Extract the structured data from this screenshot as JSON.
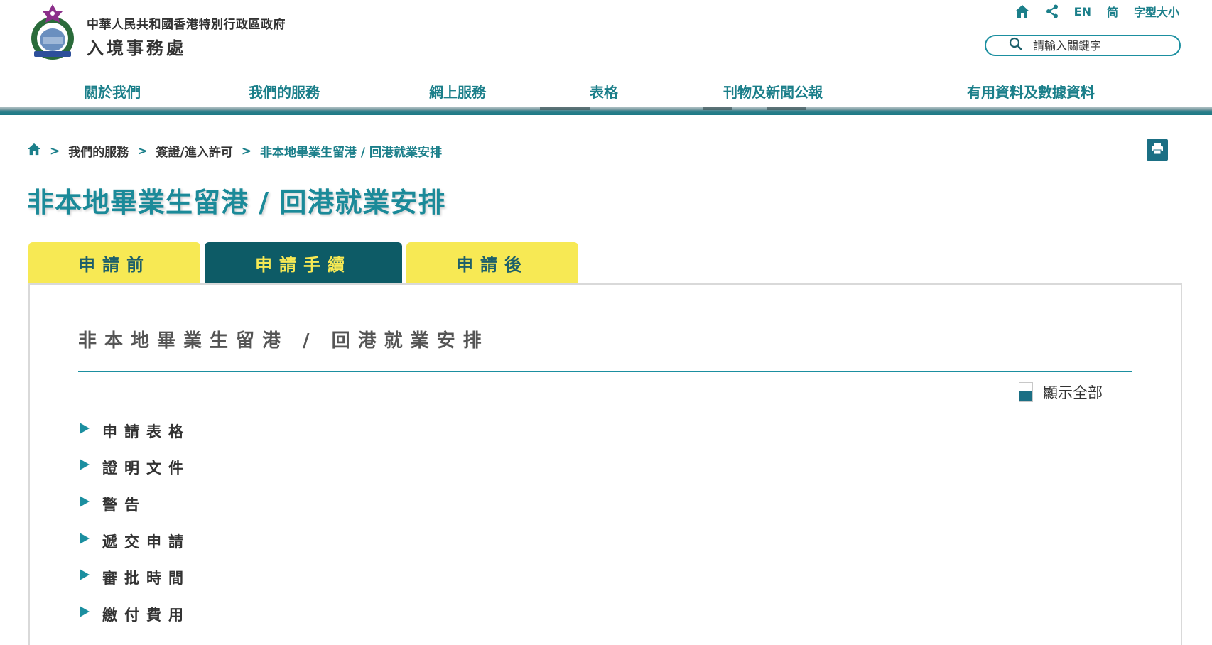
{
  "header": {
    "dept_line1": "中華人民共和國香港特別行政區政府",
    "dept_line2": "入境事務處",
    "util": {
      "home_icon": "home-icon",
      "share_icon": "share-icon",
      "lang_en": "EN",
      "lang_sc": "简",
      "font_size": "字型大小"
    },
    "search": {
      "placeholder": "請輸入關鍵字",
      "icon": "search-icon"
    }
  },
  "nav": {
    "items": [
      "關於我們",
      "我們的服務",
      "網上服務",
      "表格",
      "刊物及新聞公報",
      "有用資料及數據資料"
    ]
  },
  "breadcrumb": {
    "home_icon": "home-icon",
    "separator": ">",
    "items": [
      "我們的服務",
      "簽證/進入許可",
      "非本地畢業生留港 / 回港就業安排"
    ]
  },
  "page_title": "非本地畢業生留港 / 回港就業安排",
  "tabs": [
    {
      "label": "申請前",
      "active": false
    },
    {
      "label": "申請手續",
      "active": true
    },
    {
      "label": "申請後",
      "active": false
    }
  ],
  "panel": {
    "heading": "非本地畢業生留港 / 回港就業安排",
    "show_all_label": "顯示全部",
    "sections": [
      "申請表格",
      "證明文件",
      "警告",
      "遞交申請",
      "審批時間",
      "繳付費用"
    ]
  },
  "colors": {
    "accent": "#1b8fa0",
    "tab_active_bg": "#0d5b66",
    "tab_bg": "#f7e954"
  }
}
